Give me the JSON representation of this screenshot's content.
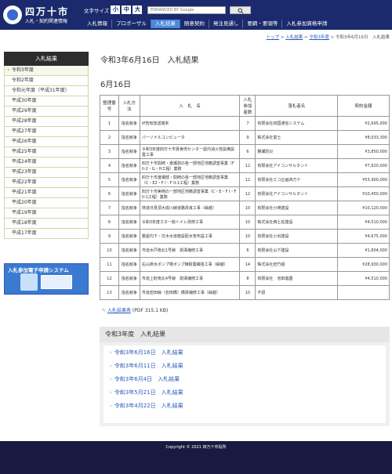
{
  "header": {
    "logo_title": "四万十市",
    "logo_sub": "入札・契約関連情報",
    "text_size_label": "文字サイズ",
    "size_small": "小",
    "size_medium": "中",
    "size_large": "大",
    "search_placeholder": "ENHANCED BY Google",
    "nav": [
      "入札情報",
      "プロポーザル",
      "入札結果",
      "随意契約",
      "発注見通し",
      "要綱・要領等",
      "入札参加資格申請"
    ]
  },
  "breadcrumb": {
    "top": "トップ",
    "results": "入札結果",
    "year": "令和3年度",
    "current": "令和3年6月16日　入札結果"
  },
  "sidebar": {
    "title": "入札結果",
    "items": [
      "令和3年度",
      "令和2年度",
      "令和元年度（平成31年度）",
      "平成30年度",
      "平成29年度",
      "平成28年度",
      "平成27年度",
      "平成26年度",
      "平成25年度",
      "平成24年度",
      "平成23年度",
      "平成22年度",
      "平成21年度",
      "平成20年度",
      "平成19年度",
      "平成18年度",
      "平成17年度"
    ],
    "banner_text": "入札参加電子申請システム"
  },
  "main": {
    "title": "令和3年6月16日　入札結果",
    "subtitle": "6月16日",
    "table_headers": {
      "num": "整理番号",
      "method": "入札方法",
      "name": "入　札　名",
      "count": "入札参加者数",
      "winner": "落札者名",
      "amount": "契約金額"
    },
    "rows": [
      {
        "num": "1",
        "method": "指名競争",
        "name": "IP告知放送端末",
        "count": "7",
        "winner": "有限会社四国通信システム",
        "amount": "¥2,695,000"
      },
      {
        "num": "2",
        "method": "指名競争",
        "name": "パーソナルコンピュータ",
        "count": "9",
        "winner": "株式会社富士",
        "amount": "¥8,033,300"
      },
      {
        "num": "3",
        "method": "指名競争",
        "name": "令和3年度四万十市賃食肉センター屋内消火栓設備設置工事",
        "count": "6",
        "winner": "勝瀬防災",
        "amount": "¥3,850,000"
      },
      {
        "num": "4",
        "method": "指名競争",
        "name": "四万十市間崎・渡瀬測の各一部地区地籍調査事業（F II-2・G・H工程）業務",
        "count": "12",
        "winner": "有限会社アイコンサルタント",
        "amount": "¥7,920,000"
      },
      {
        "num": "5",
        "method": "指名競争",
        "name": "四万十市渡瀬部・間崎の各一部地区地籍調査事業（C・E2・F I・F II-1工程）業務",
        "count": "12",
        "winner": "有限会社エコ企画四万十",
        "amount": "¥53,900,000"
      },
      {
        "num": "6",
        "method": "指名競争",
        "name": "四万十市実崎の一部地区地籍調査事業（C・E・F I・F II-1工程）業務",
        "count": "12",
        "winner": "有限会社アイコンサルタント",
        "amount": "¥10,450,000"
      },
      {
        "num": "7",
        "method": "指名競争",
        "name": "林道日見須大成川線道路改良工事（繰越）",
        "count": "10",
        "winner": "有限会社小崎建設",
        "amount": "¥10,120,000"
      },
      {
        "num": "8",
        "method": "指名競争",
        "name": "令和3年度カヌー館トイレ改修工事",
        "count": "10",
        "winner": "株式会社西土佐建設",
        "amount": "¥4,510,000"
      },
      {
        "num": "9",
        "method": "指名競争",
        "name": "悪屋内下・坑木水道施設配水管布設工事",
        "count": "10",
        "winner": "有限会社小出建設",
        "amount": "¥4,675,000"
      },
      {
        "num": "10",
        "method": "指名競争",
        "name": "市道水戸南北1号線　測溝補修工事",
        "count": "6",
        "winner": "有限会社山下建設",
        "amount": "¥1,804,000"
      },
      {
        "num": "11",
        "method": "指名競争",
        "name": "右山排水ポンプ場ポンプ棟耐震補強工事（繰越）",
        "count": "14",
        "winner": "株式会社岩竹組",
        "amount": "¥28,930,000"
      },
      {
        "num": "12",
        "method": "指名競争",
        "name": "市道上町南北4号線　測溝補修工事",
        "count": "8",
        "winner": "有限会社　池田進園",
        "amount": "¥4,510,000"
      },
      {
        "num": "13",
        "method": "指名競争",
        "name": "市道岩田線（岩田橋）橋梁補修工事（繰越）",
        "count": "10",
        "winner": "不調",
        "amount": ""
      }
    ],
    "pdf_link": "入札結果表",
    "pdf_info": "(PDF 315.1 KB)",
    "list_title": "令和3年度　入札結果",
    "list_links": [
      "令和3年6月16日　入札結果",
      "令和3年6月11日　入札結果",
      "令和3年6月4日　入札結果",
      "令和3年5月21日　入札結果",
      "令和3年4月22日　入札結果"
    ]
  },
  "footer": {
    "copyright": "Copyright © 2021 四万十市役所"
  }
}
